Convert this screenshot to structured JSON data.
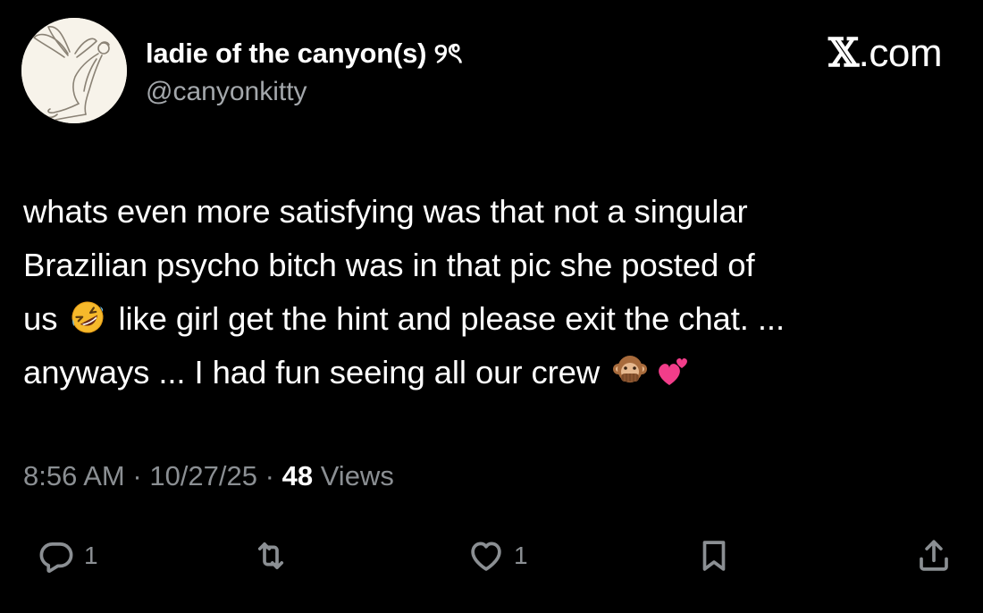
{
  "author": {
    "display_name": "ladie of the canyon(s) ୨ৎ",
    "handle": "@canyonkitty"
  },
  "watermark": {
    "x_letter": "𝕏",
    "domain": ".com"
  },
  "tweet": {
    "lines": [
      "whats even more satisfying was that not a singular",
      "Brazilian psycho bitch was in that pic she posted of",
      {
        "before": "us",
        "after": "like girl get the hint and please exit the chat. ..."
      },
      {
        "before": "anyways ... I had fun seeing all our crew"
      }
    ],
    "emoji": {
      "laugh": "rolling-on-floor-laughing-emoji",
      "monkey": "speak-no-evil-monkey-emoji",
      "hearts": "two-hearts-emoji"
    }
  },
  "meta": {
    "time": "8:56 AM",
    "date": "10/27/25",
    "views_count": "48",
    "views_label": "Views",
    "separator": "·"
  },
  "actions": {
    "reply_count": "1",
    "like_count": "1",
    "icons": [
      "reply-icon",
      "retweet-icon",
      "like-icon",
      "bookmark-icon",
      "share-icon"
    ]
  },
  "colors": {
    "background": "#000000",
    "text_primary": "#ffffff",
    "text_secondary": "#8b8f93"
  }
}
